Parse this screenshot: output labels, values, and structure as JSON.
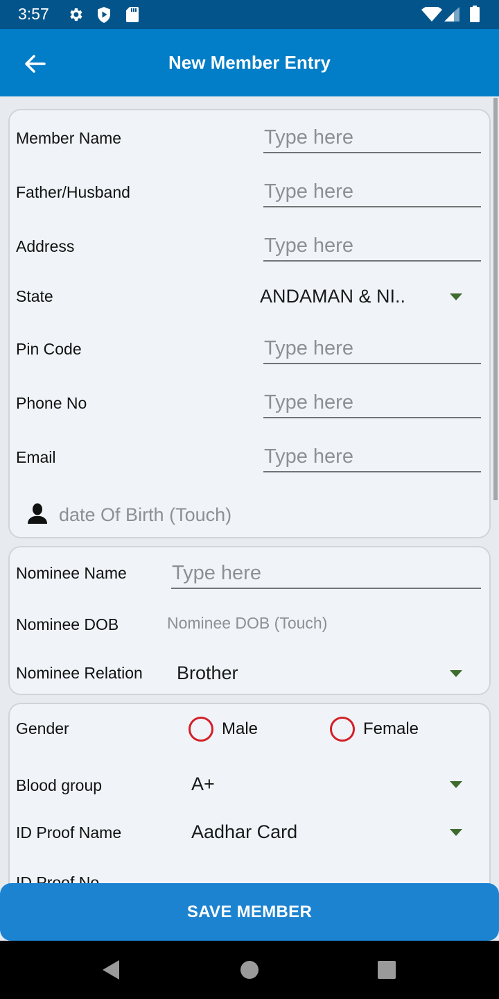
{
  "status_bar": {
    "time": "3:57",
    "left_icons": [
      "settings-gear-icon",
      "shield-play-icon",
      "sd-card-icon"
    ],
    "right_icons": [
      "wifi-icon",
      "cell-signal-icon",
      "battery-icon"
    ]
  },
  "app_bar": {
    "back_icon": "arrow-left-icon",
    "title": "New Member Entry",
    "background_color": "#027dc8"
  },
  "member_card": {
    "fields": [
      {
        "label": "Member Name",
        "placeholder": "Type here",
        "value": ""
      },
      {
        "label": "Father/Husband",
        "placeholder": "Type here",
        "value": ""
      },
      {
        "label": "Address",
        "placeholder": "Type here",
        "value": ""
      },
      {
        "label": "Pin Code",
        "placeholder": "Type here",
        "value": ""
      },
      {
        "label": "Phone No",
        "placeholder": "Type here",
        "value": ""
      },
      {
        "label": "Email",
        "placeholder": "Type here",
        "value": ""
      }
    ],
    "state": {
      "label": "State",
      "selected": "ANDAMAN & NI.."
    },
    "dob": {
      "icon": "person-silhouette-icon",
      "text": "date Of Birth (Touch)"
    }
  },
  "nominee_card": {
    "name": {
      "label": "Nominee Name",
      "placeholder": "Type here",
      "value": ""
    },
    "dob": {
      "label": "Nominee DOB",
      "text": "Nominee DOB (Touch)"
    },
    "relation": {
      "label": "Nominee Relation",
      "selected": "Brother"
    }
  },
  "details_card": {
    "gender": {
      "label": "Gender",
      "options": [
        "Male",
        "Female"
      ],
      "selected": null
    },
    "blood_group": {
      "label": "Blood group",
      "selected": "A+"
    },
    "id_proof_name": {
      "label": "ID Proof Name",
      "selected": "Aadhar Card"
    },
    "id_proof_no": {
      "label": "ID Proof No"
    }
  },
  "save_button": {
    "label": "SAVE MEMBER",
    "color": "#1c83d1"
  },
  "nav_bar": {
    "buttons": [
      "back-triangle-icon",
      "home-circle-icon",
      "recents-square-icon"
    ]
  },
  "colors": {
    "status_bar": "#03548a",
    "radio_ring": "#d32027",
    "dropdown_caret": "#3e6b2e",
    "placeholder": "#8c9094"
  }
}
